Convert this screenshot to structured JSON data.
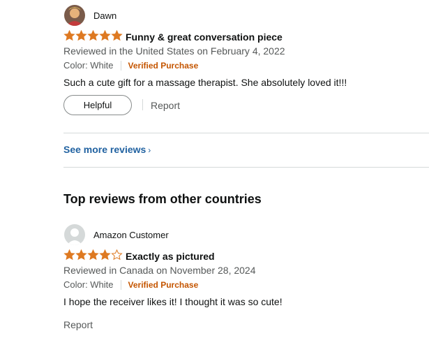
{
  "colors": {
    "star": "#de7921",
    "verified": "#c45500",
    "link": "#2162a1",
    "muted": "#565959",
    "divider": "#d5d9d9"
  },
  "review1": {
    "reviewer_name": "Dawn",
    "avatar_icon": "user-photo-avatar",
    "rating": 5,
    "title": "Funny & great conversation piece",
    "date_text": "Reviewed in the United States on February 4, 2022",
    "color_label": "Color: White",
    "verified_label": "Verified Purchase",
    "body": "Such a cute gift for a massage therapist. She absolutely loved it!!!",
    "helpful_label": "Helpful",
    "report_label": "Report"
  },
  "see_more_label": "See more reviews",
  "other_countries_heading": "Top reviews from other countries",
  "review2": {
    "reviewer_name": "Amazon Customer",
    "avatar_icon": "default-user-avatar",
    "rating": 4,
    "title": "Exactly as pictured",
    "date_text": "Reviewed in Canada on November 28, 2024",
    "color_label": "Color: White",
    "verified_label": "Verified Purchase",
    "body": "I hope the receiver likes it! I thought it was so cute!",
    "report_label": "Report"
  }
}
